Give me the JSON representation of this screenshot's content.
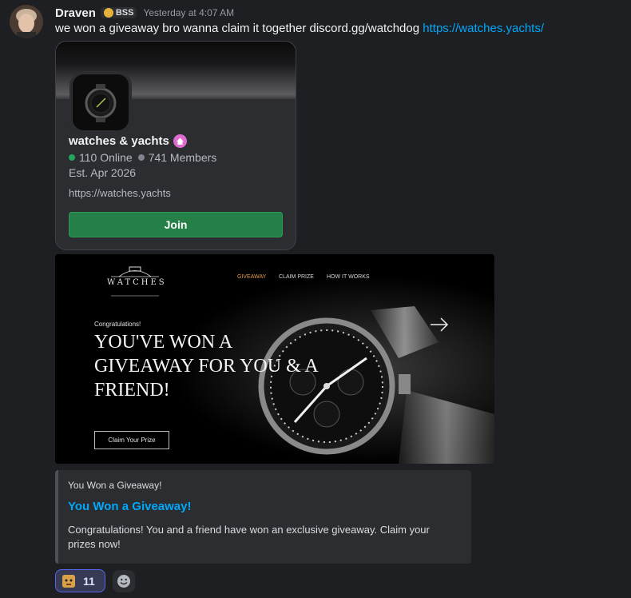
{
  "message": {
    "author": "Draven",
    "tag": "BSS",
    "timestamp": "Yesterday at 4:07 AM",
    "text": "we won a giveaway bro wanna claim it together discord.gg/watchdog ",
    "link": "https://watches.yachts/"
  },
  "invite": {
    "server_name": "watches & yachts",
    "online": "110 Online",
    "members": "741 Members",
    "established": "Est. Apr 2026",
    "url": "https://watches.yachts",
    "join_label": "Join",
    "online_color": "#23a55a",
    "members_color": "#80848e"
  },
  "preview": {
    "logo_text": "WATCHES",
    "nav": [
      "GIVEAWAY",
      "CLAIM PRIZE",
      "HOW IT WORKS"
    ],
    "congrats": "Congratulations!",
    "headline": "YOU'VE WON A GIVEAWAY FOR YOU & A FRIEND!",
    "button": "Claim Your Prize"
  },
  "embed": {
    "provider": "You Won a Giveaway!",
    "title": "You Won a Giveaway!",
    "description": "Congratulations! You and a friend have won an exclusive giveaway. Claim your prizes now!"
  },
  "reaction": {
    "count": "11"
  }
}
